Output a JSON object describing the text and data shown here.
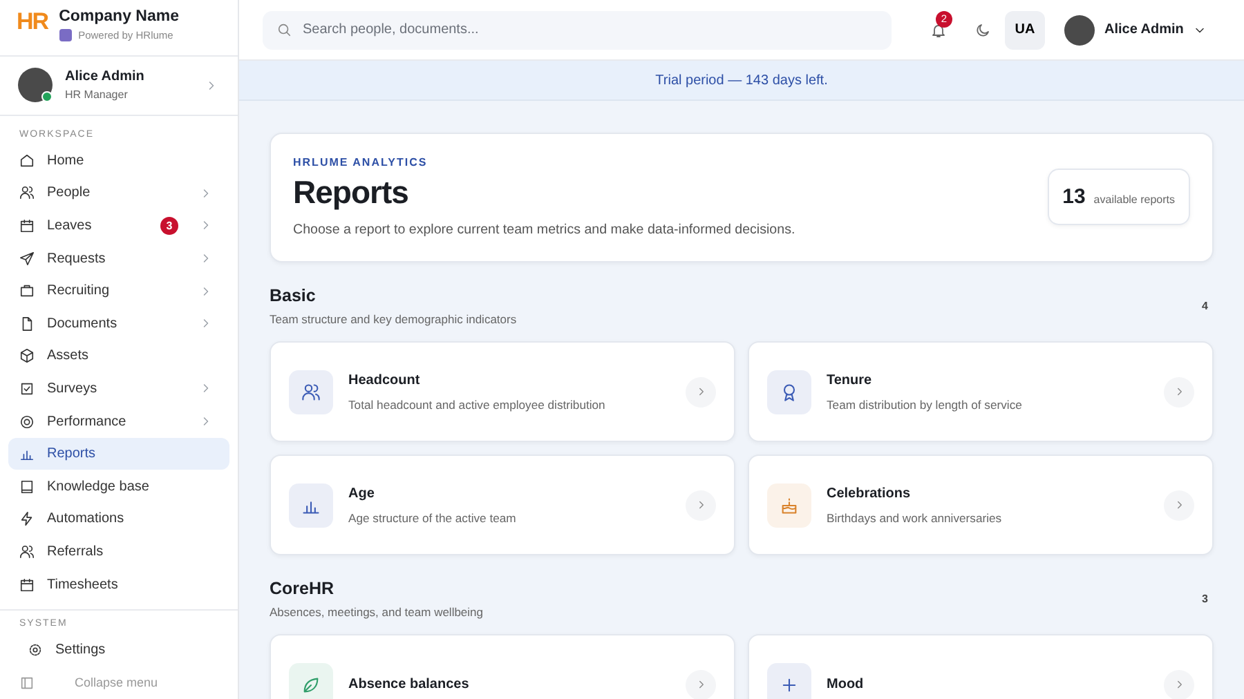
{
  "brand": {
    "logo": "HR",
    "company": "Company Name",
    "powered_by": "Powered by HRlume"
  },
  "sidebar_user": {
    "name": "Alice Admin",
    "role": "HR Manager",
    "online": true
  },
  "sidebar": {
    "workspace_label": "WORKSPACE",
    "items": [
      {
        "label": "Home",
        "kind": "home",
        "chevron": false,
        "selected": false
      },
      {
        "label": "People",
        "kind": "people",
        "chevron": true,
        "selected": false
      },
      {
        "label": "Leaves",
        "kind": "calendar",
        "chevron": true,
        "badge": "3",
        "selected": false
      },
      {
        "label": "Requests",
        "kind": "send",
        "chevron": true,
        "selected": false
      },
      {
        "label": "Recruiting",
        "kind": "briefcase",
        "chevron": true,
        "selected": false
      },
      {
        "label": "Documents",
        "kind": "file",
        "chevron": true,
        "selected": false
      },
      {
        "label": "Assets",
        "kind": "box",
        "chevron": false,
        "selected": false
      },
      {
        "label": "Surveys",
        "kind": "check",
        "chevron": true,
        "selected": false
      },
      {
        "label": "Performance",
        "kind": "target",
        "chevron": true,
        "selected": false
      },
      {
        "label": "Reports",
        "kind": "chart",
        "chevron": false,
        "selected": true
      },
      {
        "label": "Knowledge base",
        "kind": "book",
        "chevron": false,
        "selected": false
      },
      {
        "label": "Automations",
        "kind": "bolt",
        "chevron": false,
        "selected": false
      },
      {
        "label": "Referrals",
        "kind": "people",
        "chevron": false,
        "selected": false
      },
      {
        "label": "Timesheets",
        "kind": "calendar",
        "chevron": false,
        "selected": false
      }
    ],
    "system_label": "SYSTEM",
    "settings": "Settings",
    "collapse": "Collapse menu"
  },
  "topbar": {
    "search_placeholder": "Search people, documents...",
    "notifications": "2",
    "language": "UA",
    "user": "Alice Admin"
  },
  "banner": "Trial period — 143 days left.",
  "hero": {
    "eyebrow": "HRLUME ANALYTICS",
    "title": "Reports",
    "description": "Choose a report to explore current team metrics and make data-informed decisions.",
    "count": "13",
    "count_label": "available reports"
  },
  "sections": [
    {
      "title": "Basic",
      "subtitle": "Team structure and key demographic indicators",
      "count": "4",
      "cards": [
        {
          "title": "Headcount",
          "description": "Total headcount and active employee distribution",
          "kind": "people",
          "color": "#3b5bb5"
        },
        {
          "title": "Tenure",
          "description": "Team distribution by length of service",
          "kind": "award",
          "color": "#3b5bb5"
        },
        {
          "title": "Age",
          "description": "Age structure of the active team",
          "kind": "chart",
          "color": "#3b5bb5"
        },
        {
          "title": "Celebrations",
          "description": "Birthdays and work anniversaries",
          "kind": "cake",
          "color": "#d9822b"
        }
      ]
    },
    {
      "title": "CoreHR",
      "subtitle": "Absences, meetings, and team wellbeing",
      "count": "3",
      "cards": [
        {
          "title": "Absence balances",
          "kind": "leaf",
          "color": "#2f9e6a"
        },
        {
          "title": "Mood",
          "kind": "plus",
          "color": "#3b5bb5"
        }
      ]
    }
  ]
}
